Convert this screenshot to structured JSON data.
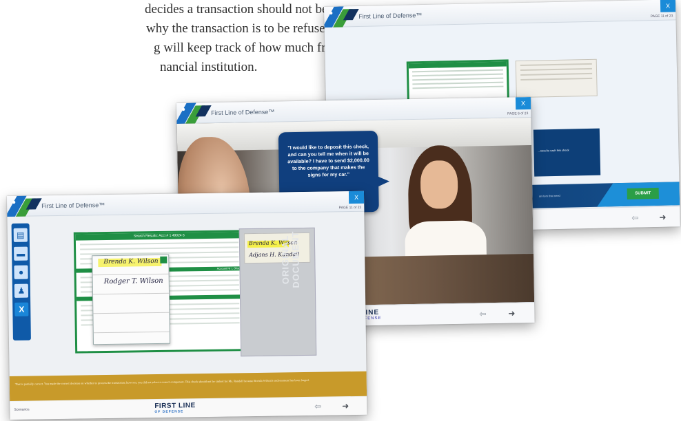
{
  "intro": {
    "line1": "decides a transaction should not be",
    "line2": "why the transaction is to be refused.",
    "line3": "g will keep track of how much fraud",
    "line4": "nancial institution."
  },
  "app_title": "First Line of Defense™",
  "window_back": {
    "close": "X",
    "page": "PAGE 11 of 23",
    "band_text": "an item that need",
    "submit": "SUBMIT",
    "block_text": "...need to cash this check"
  },
  "window_mid": {
    "close": "X",
    "page": "PAGE 6 of 23",
    "bubble": "\"I would like to deposit this check, and can you tell me when it will be available? I have to send $2,000.00 to the company that makes the signs for my car.\"",
    "logo_top": "LINE",
    "logo_sub": "EFENSE"
  },
  "window_front": {
    "close": "X",
    "page": "PAGE 11 of 23",
    "sidebar": [
      "document-icon",
      "card-icon",
      "id-icon",
      "user-icon"
    ],
    "sidebar_close": "X",
    "doc_title": "Search Results: Acct # 1 49024 6",
    "doc_section": "Account Nr 1 Ohsu",
    "sig1": "Brenda K. Wilson",
    "sig2": "Rodger T. Wilson",
    "orig_sig1": "Brenda K. Wilson",
    "orig_sig2": "Adjans H. Kundall",
    "orig_label_1": "ORIGINAL",
    "orig_label_2": "DOCUMENT",
    "feedback": "That is partially correct. You made the correct decision on whether to process the transaction; however, you did not select a correct component. This check should not be cashed for Ms. Randall because Brenda Wilson's endorsement has been forged.",
    "scenario": "Scenarios",
    "footer_logo_top": "FIRST LINE",
    "footer_logo_sub": "OF DEFENSE"
  },
  "colors": {
    "accent_blue": "#1a8bd8",
    "brand_green": "#1f8f45",
    "feedback_gold": "#c89a2a",
    "navy": "#103f7e"
  }
}
